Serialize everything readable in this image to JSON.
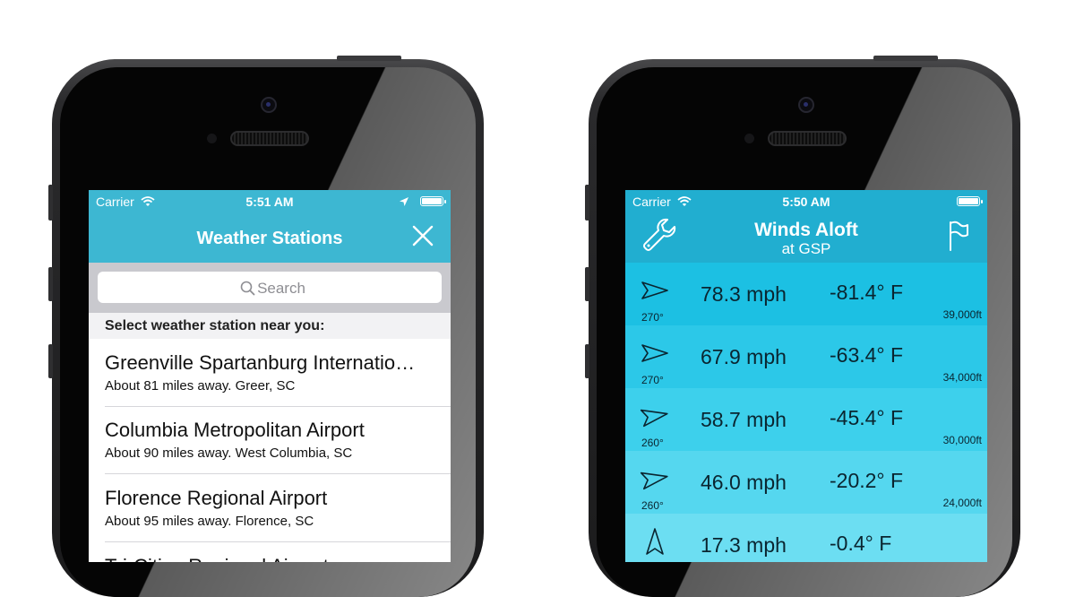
{
  "left_phone": {
    "status": {
      "carrier": "Carrier",
      "time": "5:51 AM"
    },
    "nav": {
      "title": "Weather Stations"
    },
    "search": {
      "placeholder": "Search"
    },
    "section_header": "Select weather station near you:",
    "stations": [
      {
        "name": "Greenville Spartanburg Internatio…",
        "detail": "About 81 miles away. Greer, SC"
      },
      {
        "name": "Columbia Metropolitan Airport",
        "detail": "About 90 miles away. West Columbia, SC"
      },
      {
        "name": "Florence Regional Airport",
        "detail": "About 95 miles away. Florence, SC"
      },
      {
        "name": "Tri-Cities Regional Airport",
        "detail": ""
      }
    ]
  },
  "right_phone": {
    "status": {
      "carrier": "Carrier",
      "time": "5:50 AM"
    },
    "nav": {
      "title": "Winds Aloft",
      "subtitle": "at GSP"
    },
    "winds": [
      {
        "direction": "270°",
        "direction_deg": 270,
        "speed": "78.3 mph",
        "temp": "-81.4° F",
        "altitude": "39,000ft",
        "color": "#1cc0e3"
      },
      {
        "direction": "270°",
        "direction_deg": 270,
        "speed": "67.9 mph",
        "temp": "-63.4° F",
        "altitude": "34,000ft",
        "color": "#2cc8e8"
      },
      {
        "direction": "260°",
        "direction_deg": 260,
        "speed": "58.7 mph",
        "temp": "-45.4° F",
        "altitude": "30,000ft",
        "color": "#3dd0ec"
      },
      {
        "direction": "260°",
        "direction_deg": 260,
        "speed": "46.0 mph",
        "temp": "-20.2° F",
        "altitude": "24,000ft",
        "color": "#55d7ef"
      },
      {
        "direction": "",
        "direction_deg": 180,
        "speed": "17.3 mph",
        "temp": "-0.4° F",
        "altitude": "",
        "color": "#6cdef2"
      }
    ]
  }
}
